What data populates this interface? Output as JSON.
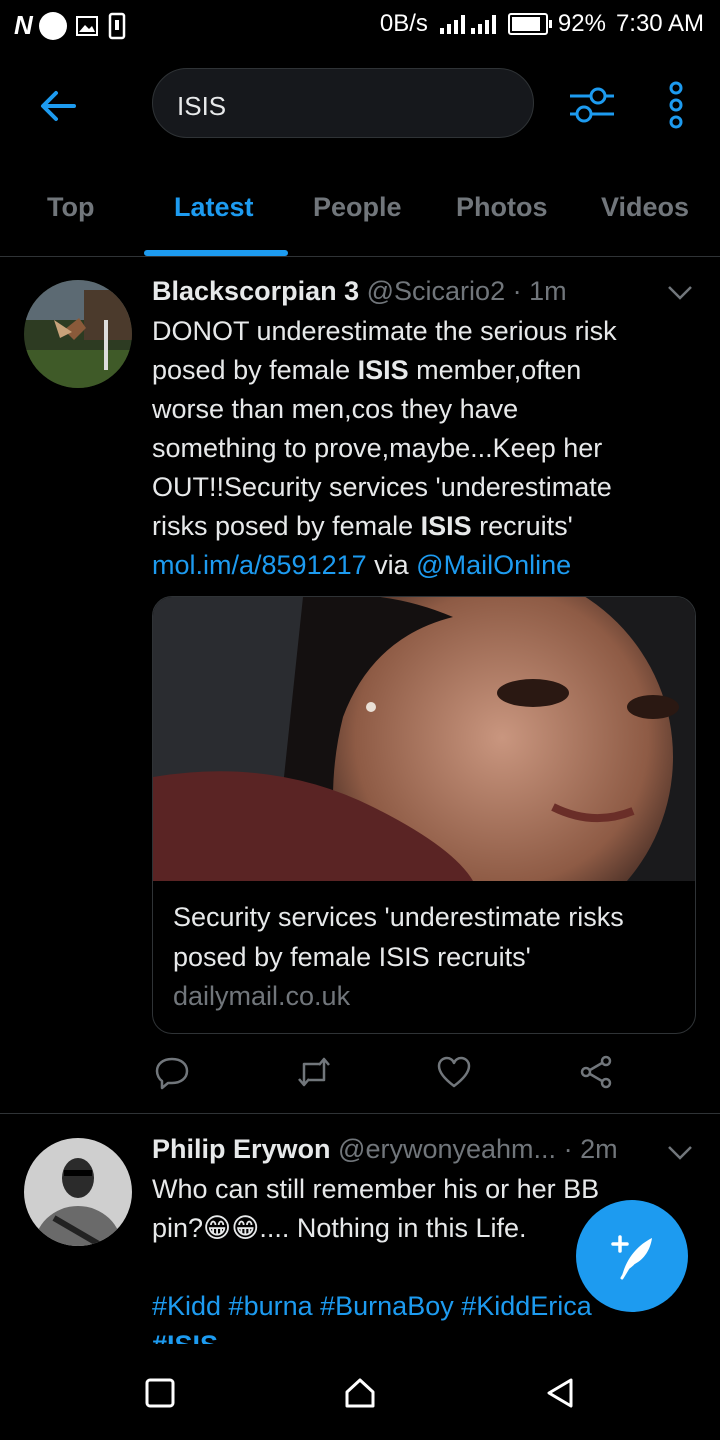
{
  "status": {
    "left_badge": "N",
    "net_speed": "0B/s",
    "battery": "92%",
    "time": "7:30 AM"
  },
  "search": {
    "query": "ISIS"
  },
  "tabs": [
    {
      "label": "Top",
      "active": false
    },
    {
      "label": "Latest",
      "active": true
    },
    {
      "label": "People",
      "active": false
    },
    {
      "label": "Photos",
      "active": false
    },
    {
      "label": "Videos",
      "active": false
    }
  ],
  "tweets": [
    {
      "name": "Blackscorpian 3",
      "handle": "@Scicario2",
      "sep": "·",
      "time": "1m",
      "lines": [
        "DONOT underestimate the serious risk",
        "posed by female ",
        "ISIS",
        " member,often",
        "worse than men,cos they have",
        "something to prove,maybe...Keep her",
        "OUT!!Security services 'underestimate",
        "risks posed by female ",
        "ISIS",
        " recruits'",
        "mol.im/a/8591217",
        " via ",
        "@MailOnline"
      ],
      "card": {
        "title": "Security services 'underestimate risks posed by female ISIS recruits'",
        "domain": "dailymail.co.uk"
      }
    },
    {
      "name": "Philip Erywon",
      "handle": "@erywonyeahm...",
      "sep": "·",
      "time": "2m",
      "line1": "Who can still remember his or her BB",
      "line2_a": "pin?",
      "emoji": "😁😁",
      "line2_b": ".... Nothing in this Life.",
      "hashtags": "#Kidd #burna #BurnaBoy #KiddErica",
      "partial": "#ISIS"
    }
  ],
  "colors": {
    "accent": "#1d9bf0",
    "background": "#000000",
    "muted": "#71767b"
  }
}
